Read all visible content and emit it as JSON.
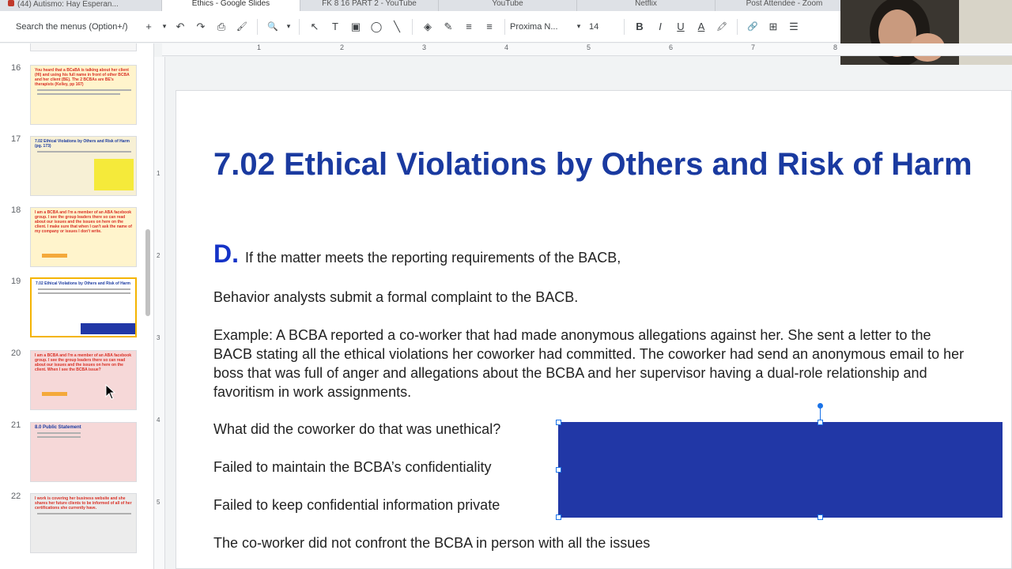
{
  "browser_tabs": [
    {
      "label": "(44) Autismo: Hay Esperan..."
    },
    {
      "label": "Ethics - Google Slides",
      "active": true
    },
    {
      "label": "FK 8 16 PART 2 - YouTube"
    },
    {
      "label": "YouTube"
    },
    {
      "label": "Netflix"
    },
    {
      "label": "Post Attendee - Zoom"
    }
  ],
  "toolbar": {
    "menu_search": "Search the menus (Option+/)",
    "font_name": "Proxima N...",
    "font_size": "14"
  },
  "icons": {
    "plus": "+",
    "undo": "↶",
    "redo": "↷",
    "print": "⎙",
    "paint": "🖌",
    "zoom": "🔍",
    "select": "↖",
    "textbox": "T",
    "image": "▣",
    "shapes": "◯",
    "line": "╲",
    "fill": "◈",
    "pen": "✎",
    "border": "≡",
    "bold": "B",
    "italic": "I",
    "underline": "U",
    "textcolor": "A",
    "highlight": "🖍",
    "link": "🔗",
    "comment": "⊞",
    "align": "☰",
    "caret": "▾"
  },
  "ruler": {
    "h": [
      "1",
      "2",
      "3",
      "4",
      "5",
      "6",
      "7",
      "8"
    ],
    "v": [
      "1",
      "2",
      "3",
      "4",
      "5"
    ]
  },
  "slides": [
    {
      "num": "16",
      "title": "You heard that a BCaBA is talking about her client (HI) and using his full name in front of other BCBA and her client (BE). The 2 BCBAs are BE's therapists (Kelley, pp 167)",
      "color": "#fff4cc",
      "title_color": "red"
    },
    {
      "num": "17",
      "title": "7.02 Ethical Violations by Others and Risk of Harm (pg. 173)",
      "color": "#f7f0d5",
      "title_color": "blue"
    },
    {
      "num": "18",
      "title": "I am a BCBA and I'm a member of an ABA facebook group. I see the group leaders there so can read about our issues and the issues on here on the client. I make sure that when I can't ask the name of my company or issues I don't write.",
      "color": "#fff4cc",
      "title_color": "red"
    },
    {
      "num": "19",
      "title": "7.02 Ethical Violations by Others and Risk of Harm",
      "color": "#ffffff",
      "title_color": "blue",
      "selected": true
    },
    {
      "num": "20",
      "title": "I am a BCBA and I'm a member of an ABA facebook group. I see the group leaders there so can read about our issues and the issues on here on the client. When I see the BCBA issue?",
      "color": "#f6d8d8",
      "title_color": "red"
    },
    {
      "num": "21",
      "title": "8.0 Public Statement",
      "color": "#f6d8d8",
      "title_color": "blue"
    },
    {
      "num": "22",
      "title": "I work is covering her business website and she shares her future clients to be informed of all of her certifications she currently have.",
      "color": "#ececec",
      "title_color": "red"
    }
  ],
  "slide": {
    "title": "7.02 Ethical Violations by Others and Risk of Harm",
    "d_letter": "D.",
    "line1": "If the matter meets the reporting requirements of the BACB,",
    "line2": "Behavior analysts submit a formal complaint to the BACB.",
    "example": "Example: A BCBA reported a co-worker that had made anonymous allegations against her.  She sent a letter to the BACB stating all the ethical violations her coworker had committed. The coworker had send an anonymous email to her boss that was full of anger and allegations about the BCBA and her supervisor having a dual-role relationship and favoritism in work assignments.",
    "question": "What did the coworker do that was unethical?",
    "answer1": "Failed to maintain the BCBA’s  confidentiality",
    "answer2": "Failed to keep confidential information private",
    "answer3": "The co-worker did not confront the BCBA in person with all the issues",
    "rect_color": "#2137a6"
  }
}
